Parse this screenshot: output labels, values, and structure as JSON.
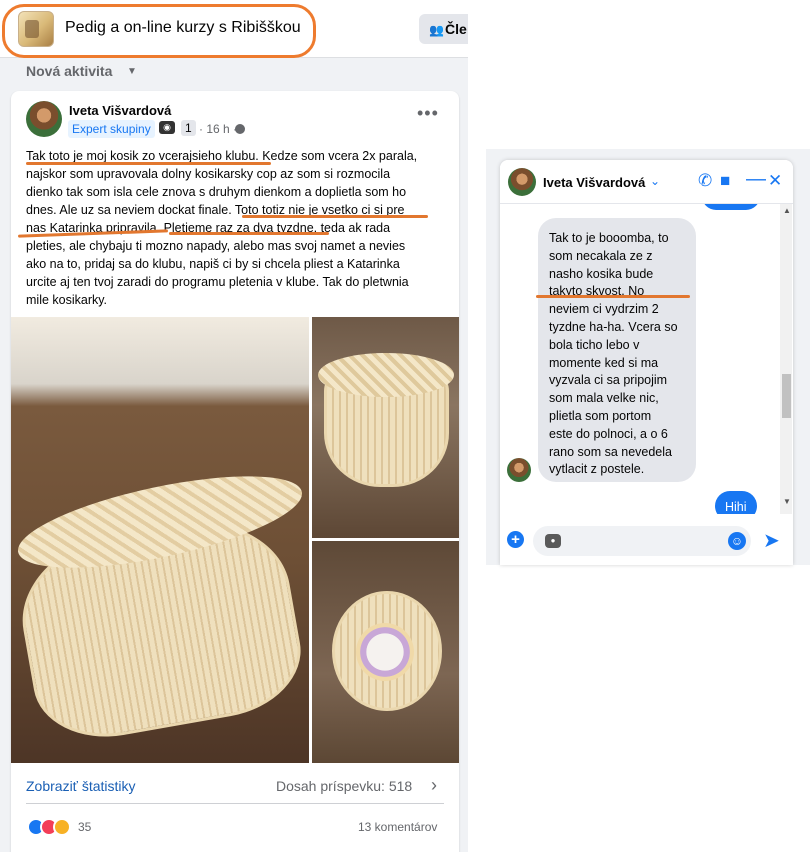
{
  "group": {
    "name": "Pedig a on-line kurzy s Ribišškou",
    "members_label": "Čle"
  },
  "feed": {
    "sort_label": "Nová aktivita"
  },
  "post": {
    "author": "Iveta Višvardová",
    "badge": "Expert skupiny",
    "badge_icon_count": "1",
    "time": "16 h",
    "text_lines": [
      "Tak toto je moj kosik zo vcerajsieho klubu. Kedze som vcera 2x parala,",
      "najskor som upravovala dolny kosikarsky cop az som si rozmocila",
      "dienko tak som isla cele znova s druhym dienkom a doplietla som ho",
      "dnes. Ale uz sa neviem dockat finale. Toto totiz nie je vsetko ci si pre",
      "nas Katarinka pripravila. Pletieme raz za dva tyzdne, teda ak rada",
      "pleties, ale chybaju ti mozno napady, alebo mas svoj namet a nevies",
      "ako na to, pridaj sa do klubu, napiš ci by si chcela pliest a Katarinka",
      "urcite aj ten tvoj zaradi do programu pletenia v klube. Tak do pletwnia",
      "mile kosikarky."
    ],
    "stats_link": "Zobraziť štatistiky",
    "reach": "Dosah príspevku: 518",
    "reactions_count": "35",
    "comments": "13 komentárov"
  },
  "chat": {
    "contact_name": "Iveta Višvardová",
    "message_lines": [
      "Tak to je booomba, to",
      "som necakala ze z",
      "nasho kosika bude",
      "takyto skvost. No",
      "neviem ci vydrzim 2",
      "tyzdne ha-ha. Vcera so",
      "bola ticho lebo v",
      "momente ked si ma",
      "vyzvala ci sa pripojim",
      "som mala velke nic,",
      "plietla som portom",
      "este do polnoci, a o 6",
      "rano som sa nevedela",
      "vytlacit z postele."
    ],
    "my_reply": "Hihi"
  },
  "colors": {
    "annotation": "#e2772f",
    "accent": "#1877f2",
    "feed_bg": "#f0f2f5"
  },
  "icons": [
    "members-icon",
    "caret-down-icon",
    "globe-icon",
    "more-icon",
    "chevron-right-icon",
    "like-icon",
    "love-icon",
    "care-icon",
    "phone-icon",
    "video-icon",
    "minimize-icon",
    "close-icon",
    "add-icon",
    "gif-icon",
    "emoji-icon",
    "send-icon"
  ]
}
